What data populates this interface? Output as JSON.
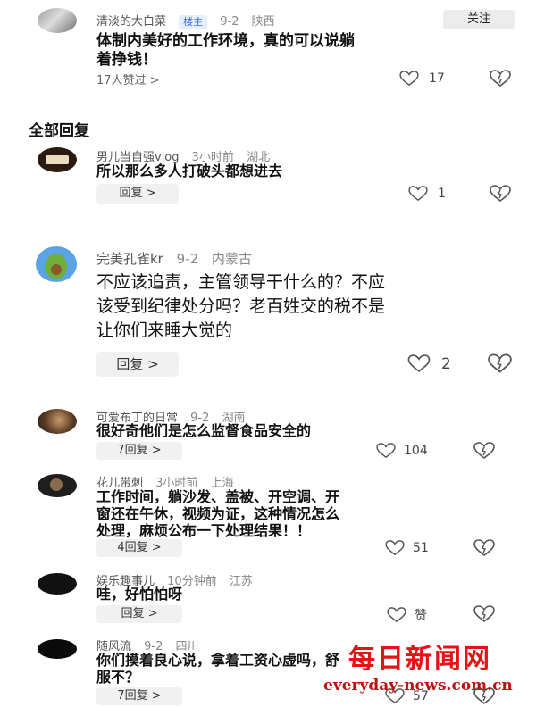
{
  "top_comment": {
    "username": "清淡的大白菜",
    "badge": "楼主",
    "date": "9-2",
    "location": "陕西",
    "follow_label": "关注",
    "text_line1": "体制内美好的工作环境，真的可以说躺",
    "text_line2": "着挣钱！",
    "likes_line": "17人赞过 >",
    "like_count": "17"
  },
  "section_title": "全部回复",
  "replies": [
    {
      "username": "男儿当自强vlog",
      "time": "3小时前",
      "location": "湖北",
      "lines": [
        "所以那么多人打破头都想进去"
      ],
      "reply_label": "回复 >",
      "like_count": "1"
    },
    {
      "username": "完美孔雀kr",
      "time": "9-2",
      "location": "内蒙古",
      "lines": [
        "不应该追责，主管领导干什么的？不应",
        "该受到纪律处分吗？老百姓交的税不是",
        "让你们来睡大觉的"
      ],
      "reply_label": "回复 >",
      "like_count": "2"
    },
    {
      "username": "可爱布丁的日常",
      "time": "9-2",
      "location": "湖南",
      "lines": [
        "很好奇他们是怎么监督食品安全的"
      ],
      "reply_label": "7回复 >",
      "like_count": "104"
    },
    {
      "username": "花儿带刺",
      "time": "3小时前",
      "location": "上海",
      "lines": [
        "工作时间，躺沙发、盖被、开空调、开",
        "窗还在午休，视频为证，这种情况怎么",
        "处理，麻烦公布一下处理结果！！"
      ],
      "reply_label": "4回复 >",
      "like_count": "51"
    },
    {
      "username": "娱乐趣事儿",
      "time": "10分钟前",
      "location": "江苏",
      "lines": [
        "哇，好怕怕呀"
      ],
      "reply_label": "回复 >",
      "like_count": "赞"
    },
    {
      "username": "随风流",
      "time": "9-2",
      "location": "四川",
      "lines": [
        "你们摸着良心说，拿着工资心虚吗，舒",
        "服不？"
      ],
      "reply_label": "7回复 >",
      "like_count": "57"
    }
  ],
  "watermark": {
    "chinese": "每日新闻网",
    "english": "everyday-news.com.cn"
  },
  "colors": {
    "accent_badge": "#3b6fd4",
    "watermark": "#e31414",
    "reply_button_bg": "#f1f1f1"
  }
}
